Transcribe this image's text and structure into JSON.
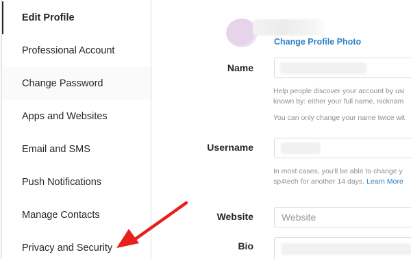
{
  "sidebar": {
    "items": [
      {
        "label": "Edit Profile"
      },
      {
        "label": "Professional Account"
      },
      {
        "label": "Change Password"
      },
      {
        "label": "Apps and Websites"
      },
      {
        "label": "Email and SMS"
      },
      {
        "label": "Push Notifications"
      },
      {
        "label": "Manage Contacts"
      },
      {
        "label": "Privacy and Security"
      }
    ]
  },
  "profile": {
    "change_photo_label": "Change Profile Photo"
  },
  "form": {
    "name_label": "Name",
    "name_help_1": "Help people discover your account by usi",
    "name_help_2": "known by: either your full name, nicknam",
    "name_help_3": "You can only change your name twice wit",
    "username_label": "Username",
    "username_help_1": "In most cases, you'll be able to change y",
    "username_help_2": "sp4tech for another 14 days.",
    "username_help_link": "Learn More",
    "website_label": "Website",
    "website_placeholder": "Website",
    "bio_label": "Bio"
  },
  "colors": {
    "link": "#2a80c8",
    "arrow": "#e8201c"
  },
  "icons": {
    "annotation": "red-arrow-icon"
  }
}
